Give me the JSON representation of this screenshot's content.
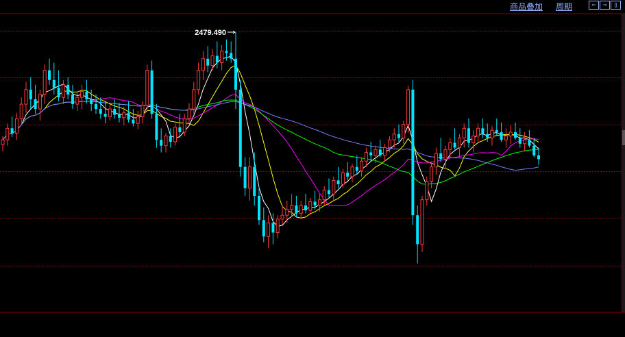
{
  "toolbar": {
    "overlay_label": "商品叠加",
    "period_label": "周期",
    "nav_left_glyph": "⇐",
    "nav_right_glyph": "⇒",
    "nav_panel_glyph": "▯"
  },
  "colors": {
    "background": "#000000",
    "grid": "#8b0000",
    "up_candle": "#ff3b3b",
    "down_candle": "#00e5ff",
    "ma_white": "#ffffff",
    "ma_yellow": "#ffff00",
    "ma_magenta": "#ff00ff",
    "ma_green": "#00ff00",
    "ma_slate": "#7b7bff"
  },
  "chart_data": {
    "type": "candlestick",
    "grid": true,
    "annotations": [
      {
        "label": "2479.490",
        "kind": "period-high"
      }
    ],
    "price_scale": {
      "min": 2249,
      "max": 2479.49
    },
    "candles": [
      [
        2363,
        2372,
        2356,
        2368
      ],
      [
        2368,
        2385,
        2362,
        2380
      ],
      [
        2380,
        2392,
        2371,
        2375
      ],
      [
        2375,
        2396,
        2368,
        2390
      ],
      [
        2390,
        2412,
        2385,
        2405
      ],
      [
        2405,
        2428,
        2396,
        2420
      ],
      [
        2420,
        2433,
        2400,
        2410
      ],
      [
        2410,
        2425,
        2395,
        2400
      ],
      [
        2400,
        2420,
        2388,
        2415
      ],
      [
        2415,
        2446,
        2405,
        2440
      ],
      [
        2440,
        2452,
        2425,
        2430
      ],
      [
        2430,
        2448,
        2415,
        2422
      ],
      [
        2422,
        2440,
        2408,
        2412
      ],
      [
        2412,
        2430,
        2405,
        2425
      ],
      [
        2425,
        2433,
        2410,
        2415
      ],
      [
        2415,
        2425,
        2400,
        2405
      ],
      [
        2405,
        2418,
        2398,
        2412
      ],
      [
        2412,
        2425,
        2400,
        2418
      ],
      [
        2418,
        2430,
        2406,
        2410
      ],
      [
        2410,
        2420,
        2398,
        2405
      ],
      [
        2405,
        2415,
        2395,
        2400
      ],
      [
        2400,
        2412,
        2390,
        2395
      ],
      [
        2395,
        2408,
        2385,
        2392
      ],
      [
        2392,
        2405,
        2388,
        2400
      ],
      [
        2400,
        2410,
        2390,
        2394
      ],
      [
        2394,
        2406,
        2386,
        2391
      ],
      [
        2391,
        2402,
        2383,
        2396
      ],
      [
        2396,
        2408,
        2386,
        2389
      ],
      [
        2389,
        2400,
        2382,
        2385
      ],
      [
        2385,
        2398,
        2379,
        2392
      ],
      [
        2392,
        2408,
        2385,
        2404
      ],
      [
        2404,
        2446,
        2398,
        2440
      ],
      [
        2440,
        2450,
        2390,
        2395
      ],
      [
        2395,
        2405,
        2360,
        2368
      ],
      [
        2368,
        2380,
        2355,
        2362
      ],
      [
        2362,
        2375,
        2355,
        2372
      ],
      [
        2372,
        2380,
        2360,
        2366
      ],
      [
        2366,
        2385,
        2362,
        2381
      ],
      [
        2381,
        2395,
        2370,
        2376
      ],
      [
        2376,
        2395,
        2372,
        2390
      ],
      [
        2390,
        2406,
        2385,
        2400
      ],
      [
        2400,
        2428,
        2395,
        2420
      ],
      [
        2420,
        2448,
        2415,
        2440
      ],
      [
        2440,
        2460,
        2430,
        2452
      ],
      [
        2452,
        2465,
        2438,
        2445
      ],
      [
        2445,
        2462,
        2440,
        2455
      ],
      [
        2455,
        2470,
        2442,
        2448
      ],
      [
        2448,
        2466,
        2440,
        2460
      ],
      [
        2460,
        2472,
        2450,
        2458
      ],
      [
        2458,
        2470,
        2448,
        2452
      ],
      [
        2452,
        2479.49,
        2400,
        2420
      ],
      [
        2420,
        2430,
        2330,
        2340
      ],
      [
        2340,
        2350,
        2310,
        2318
      ],
      [
        2318,
        2350,
        2305,
        2340
      ],
      [
        2340,
        2355,
        2300,
        2310
      ],
      [
        2310,
        2320,
        2280,
        2285
      ],
      [
        2285,
        2298,
        2262,
        2268
      ],
      [
        2268,
        2290,
        2256,
        2282
      ],
      [
        2282,
        2292,
        2260,
        2272
      ],
      [
        2272,
        2290,
        2266,
        2286
      ],
      [
        2286,
        2300,
        2280,
        2290
      ],
      [
        2290,
        2305,
        2282,
        2296
      ],
      [
        2296,
        2312,
        2288,
        2300
      ],
      [
        2300,
        2310,
        2288,
        2292
      ],
      [
        2292,
        2305,
        2286,
        2300
      ],
      [
        2300,
        2312,
        2292,
        2295
      ],
      [
        2295,
        2308,
        2290,
        2304
      ],
      [
        2304,
        2315,
        2296,
        2300
      ],
      [
        2300,
        2312,
        2294,
        2306
      ],
      [
        2306,
        2320,
        2300,
        2316
      ],
      [
        2316,
        2328,
        2308,
        2312
      ],
      [
        2312,
        2330,
        2306,
        2326
      ],
      [
        2326,
        2340,
        2318,
        2322
      ],
      [
        2322,
        2338,
        2318,
        2334
      ],
      [
        2334,
        2345,
        2326,
        2330
      ],
      [
        2330,
        2343,
        2324,
        2340
      ],
      [
        2340,
        2352,
        2332,
        2336
      ],
      [
        2336,
        2350,
        2330,
        2346
      ],
      [
        2346,
        2360,
        2340,
        2355
      ],
      [
        2355,
        2366,
        2346,
        2352
      ],
      [
        2352,
        2362,
        2344,
        2358
      ],
      [
        2358,
        2368,
        2350,
        2352
      ],
      [
        2352,
        2364,
        2346,
        2360
      ],
      [
        2360,
        2372,
        2355,
        2368
      ],
      [
        2368,
        2380,
        2360,
        2374
      ],
      [
        2374,
        2384,
        2366,
        2370
      ],
      [
        2370,
        2388,
        2364,
        2384
      ],
      [
        2384,
        2424,
        2375,
        2420
      ],
      [
        2420,
        2430,
        2280,
        2290
      ],
      [
        2290,
        2300,
        2240,
        2260
      ],
      [
        2260,
        2310,
        2252,
        2306
      ],
      [
        2306,
        2330,
        2300,
        2325
      ],
      [
        2325,
        2345,
        2318,
        2340
      ],
      [
        2340,
        2360,
        2332,
        2354
      ],
      [
        2354,
        2370,
        2345,
        2348
      ],
      [
        2348,
        2362,
        2338,
        2358
      ],
      [
        2358,
        2370,
        2350,
        2365
      ],
      [
        2365,
        2380,
        2358,
        2360
      ],
      [
        2360,
        2374,
        2350,
        2370
      ],
      [
        2370,
        2385,
        2360,
        2380
      ],
      [
        2380,
        2390,
        2360,
        2365
      ],
      [
        2365,
        2378,
        2355,
        2372
      ],
      [
        2372,
        2385,
        2365,
        2380
      ],
      [
        2380,
        2390,
        2370,
        2374
      ],
      [
        2374,
        2385,
        2366,
        2370
      ],
      [
        2370,
        2382,
        2362,
        2378
      ],
      [
        2378,
        2390,
        2372,
        2376
      ],
      [
        2376,
        2386,
        2366,
        2368
      ],
      [
        2368,
        2380,
        2360,
        2372
      ],
      [
        2372,
        2383,
        2364,
        2376
      ],
      [
        2376,
        2386,
        2368,
        2370
      ],
      [
        2370,
        2380,
        2360,
        2364
      ],
      [
        2364,
        2376,
        2356,
        2368
      ],
      [
        2368,
        2378,
        2360,
        2362
      ],
      [
        2362,
        2370,
        2350,
        2352
      ],
      [
        2352,
        2360,
        2342,
        2348
      ]
    ]
  }
}
